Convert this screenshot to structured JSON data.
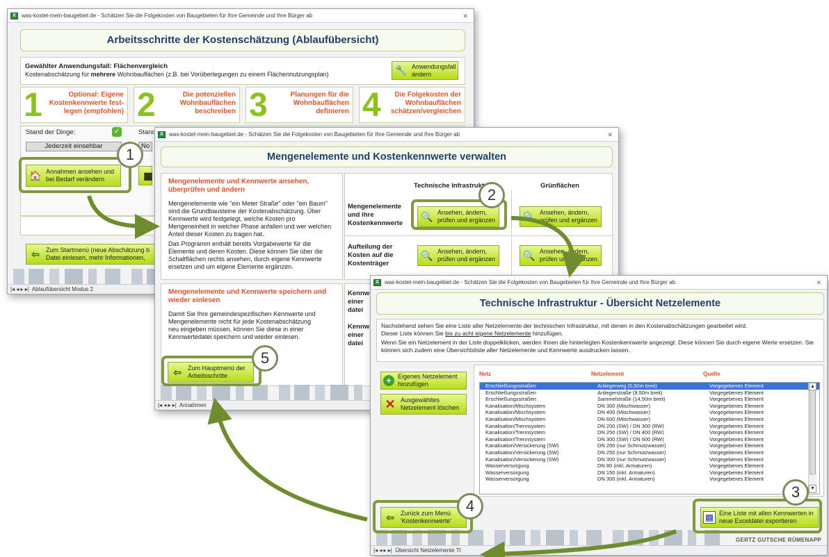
{
  "window1": {
    "title": "was-kostet-mein-baugebiet.de - Schätzen Sie die Folgekosten von Baugebieten für Ihre Gemeinde und Ihre Bürger ab",
    "header": "Arbeitsschritte der Kostenschätzung (Ablaufübersicht)",
    "case_label": "Gewählter Anwendungsfall: Flächenvergleich",
    "case_desc_pre": "Kostenabschätzung für ",
    "case_desc_bold": "mehrere",
    "case_desc_post": " Wohnbauflächen (z.B. bei Vorüberlegungen zu einem Flächennutzungsplan)",
    "change_case_button": "Anwendungsfall ändern",
    "steps": [
      {
        "number": "1",
        "text": "Optional: Eigene Kostenkennwerte fest-legen (empfohlen)"
      },
      {
        "number": "2",
        "text": "Die potenziellen Wohnbauflächen beschreiben"
      },
      {
        "number": "3",
        "text": "Planungen für die Wohnbauflächen definieren"
      },
      {
        "number": "4",
        "text": "Die Folgekosten der Wohnbauflächen schätzen/vergleichen"
      }
    ],
    "status_label": "Stand der Dinge:",
    "status_label_2": "Stand",
    "status_value": "Jederzeit einsehbar",
    "status_value_2": "No",
    "assumptions_button": "Annahmen ansehen und bei Bedarf verändern",
    "start_menu_button": "Zum Startmenü (neue Abschätzung b... Datei einlesen, mehr Informationen, ...",
    "start_menu_button_l1": "Zum Startmenü (neue Abschätzung b",
    "start_menu_button_l2": "Datei einlesen, mehr Informationen,",
    "sheet_tab": "Ablaufübersicht Modus 2"
  },
  "window2": {
    "title": "was-kostet-mein-baugebiet.de - Schätzen Sie die Folgekosten von Baugebieten für Ihre Gemeinde und Ihre Bürger ab",
    "header": "Mengenelemente und Kostenkennwerte verwalten",
    "section1_title": "Mengenelemente und Kennwerte ansehen, überprüfen und ändern",
    "section1_p1": "Mengenelemente wie \"ein Meter Straße\" oder \"ein Baum\" sind die Grundbausteine der Kostenabschätzung. Über Kennwerte wird festgelegt, welche Kosten pro Mengeneinheit in welcher Phase anfallen und wer welchen Anteil dieser Kosten zu tragen hat.",
    "section1_p2": "Das Programm enthält bereits Vorgabewerte für die Elemente und deren Kosten. Diese können Sie über die Schaltflächen rechts ansehen, durch eigene Kennwerte ersetzen und um eigene Elemente ergänzen.",
    "section2_title": "Mengenelemente und Kennwerte speichern und wieder einlesen",
    "section2_p": "Damit Sie Ihre gemeindespezifischen Kennwerte und Mengenelemente nicht für jede Kostenabschätzung neu eingeben müssen, können Sie diese in einer Kennwertedatei speichern und wieder einlesen.",
    "col_tech": "Technische Infrastruktur",
    "col_green": "Grünflächen",
    "row1_label": "Mengenelemente und ihre Kostenkennwerte",
    "row2_label": "Aufteilung der Kosten auf die Kostenträger",
    "row3_label": "Kennw einer datei",
    "row4_label": "Kennw einer datei",
    "view_button": "Ansehen, ändern, prüfen und ergänzen",
    "main_menu_button": "Zum Hauptmenü der Arbeitsschritte",
    "sheet_tab": "Annahmen"
  },
  "window3": {
    "title": "was-kostet-mein-baugebiet.de - Schätzen Sie die Folgekosten von Baugebieten für Ihre Gemeinde und Ihre Bürger ab",
    "header": "Technische Infrastruktur - Übersicht Netzelemente",
    "intro_1": "Nachstehend sehen Sie eine Liste aller Netzelemente der technischen Infrastruktur, mit denen in den Kostenabschätzungen gearbeitet wird.",
    "intro_2_pre": "Dieser Liste können Sie ",
    "intro_2_link": "bis zu acht eigene Netzelemente",
    "intro_2_post": " hinzufügen.",
    "intro_3": "Wenn Sie ein Netzelement in der Liste doppelklicken, werden Ihnen die hinterlegten Kostenkennwerte angezeigt. Diese können Sie durch eigene Werte ersetzen. Sie können sich zudem eine Übersichtsliste aller Netzelemente und Kennwerte ausdrucken lassen.",
    "add_button": "Eigenes Netzelement hinzufügen",
    "delete_button": "Ausgewähltes Netzelement löschen",
    "columns": [
      "Netz",
      "Netzelement",
      "Quelle"
    ],
    "rows": [
      [
        "Erschließungsstraßen",
        "Anliegerweg (5,50m breit)",
        "Vorgegebenes Element"
      ],
      [
        "Erschließungsstraßen",
        "Anliegerstraße (8,50m breit)",
        "Vorgegebenes Element"
      ],
      [
        "Erschließungsstraßen",
        "Sammelstraße (14,50m breit)",
        "Vorgegebenes Element"
      ],
      [
        "Kanalisation/Mischsystem",
        "DN 300 (Mischwasser)",
        "Vorgegebenes Element"
      ],
      [
        "Kanalisation/Mischsystem",
        "DN 400 (Mischwasser)",
        "Vorgegebenes Element"
      ],
      [
        "Kanalisation/Mischsystem",
        "DN 600 (Mischwasser)",
        "Vorgegebenes Element"
      ],
      [
        "Kanalisation/Trennsystem",
        "DN 200 (SW) / DN 300 (RW)",
        "Vorgegebenes Element"
      ],
      [
        "Kanalisation/Trennsystem",
        "DN 250 (SW) / DN 400 (RW)",
        "Vorgegebenes Element"
      ],
      [
        "Kanalisation/Trennsystem",
        "DN 300 (SW) / DN 600 (RW)",
        "Vorgegebenes Element"
      ],
      [
        "Kanalisation/Versickerung (SW)",
        "DN 200 (nur Schmutzwasser)",
        "Vorgegebenes Element"
      ],
      [
        "Kanalisation/Versickerung (SW)",
        "DN 250 (nur Schmutzwasser)",
        "Vorgegebenes Element"
      ],
      [
        "Kanalisation/Versickerung (SW)",
        "DN 300 (nur Schmutzwasser)",
        "Vorgegebenes Element"
      ],
      [
        "Wasserversorgung",
        "DN 80 (inkl. Armaturen)",
        "Vorgegebenes Element"
      ],
      [
        "Wasserversorgung",
        "DN 150 (inkl. Armaturen)",
        "Vorgegebenes Element"
      ],
      [
        "Wasserversorgung",
        "DN 300 (inkl. Armaturen)",
        "Vorgegebenes Element"
      ]
    ],
    "back_button": "Zurück zum Menü 'Kostenkennwerte'",
    "export_button": "Eine Liste mit allen Kennwerten in neue Exceldatei exportieren",
    "brand": "GERTZ GUTSCHE RÜMENAPP",
    "sheet_tab": "Übersicht Netzelemente TI"
  },
  "callouts": [
    "1",
    "2",
    "3",
    "4",
    "5"
  ],
  "colors": {
    "accent_green": "#8cc21e",
    "button_green": "#c4e630",
    "callout_ring": "#7f9a3c",
    "step_title": "#e2562a",
    "header_text": "#1f3e6b"
  }
}
